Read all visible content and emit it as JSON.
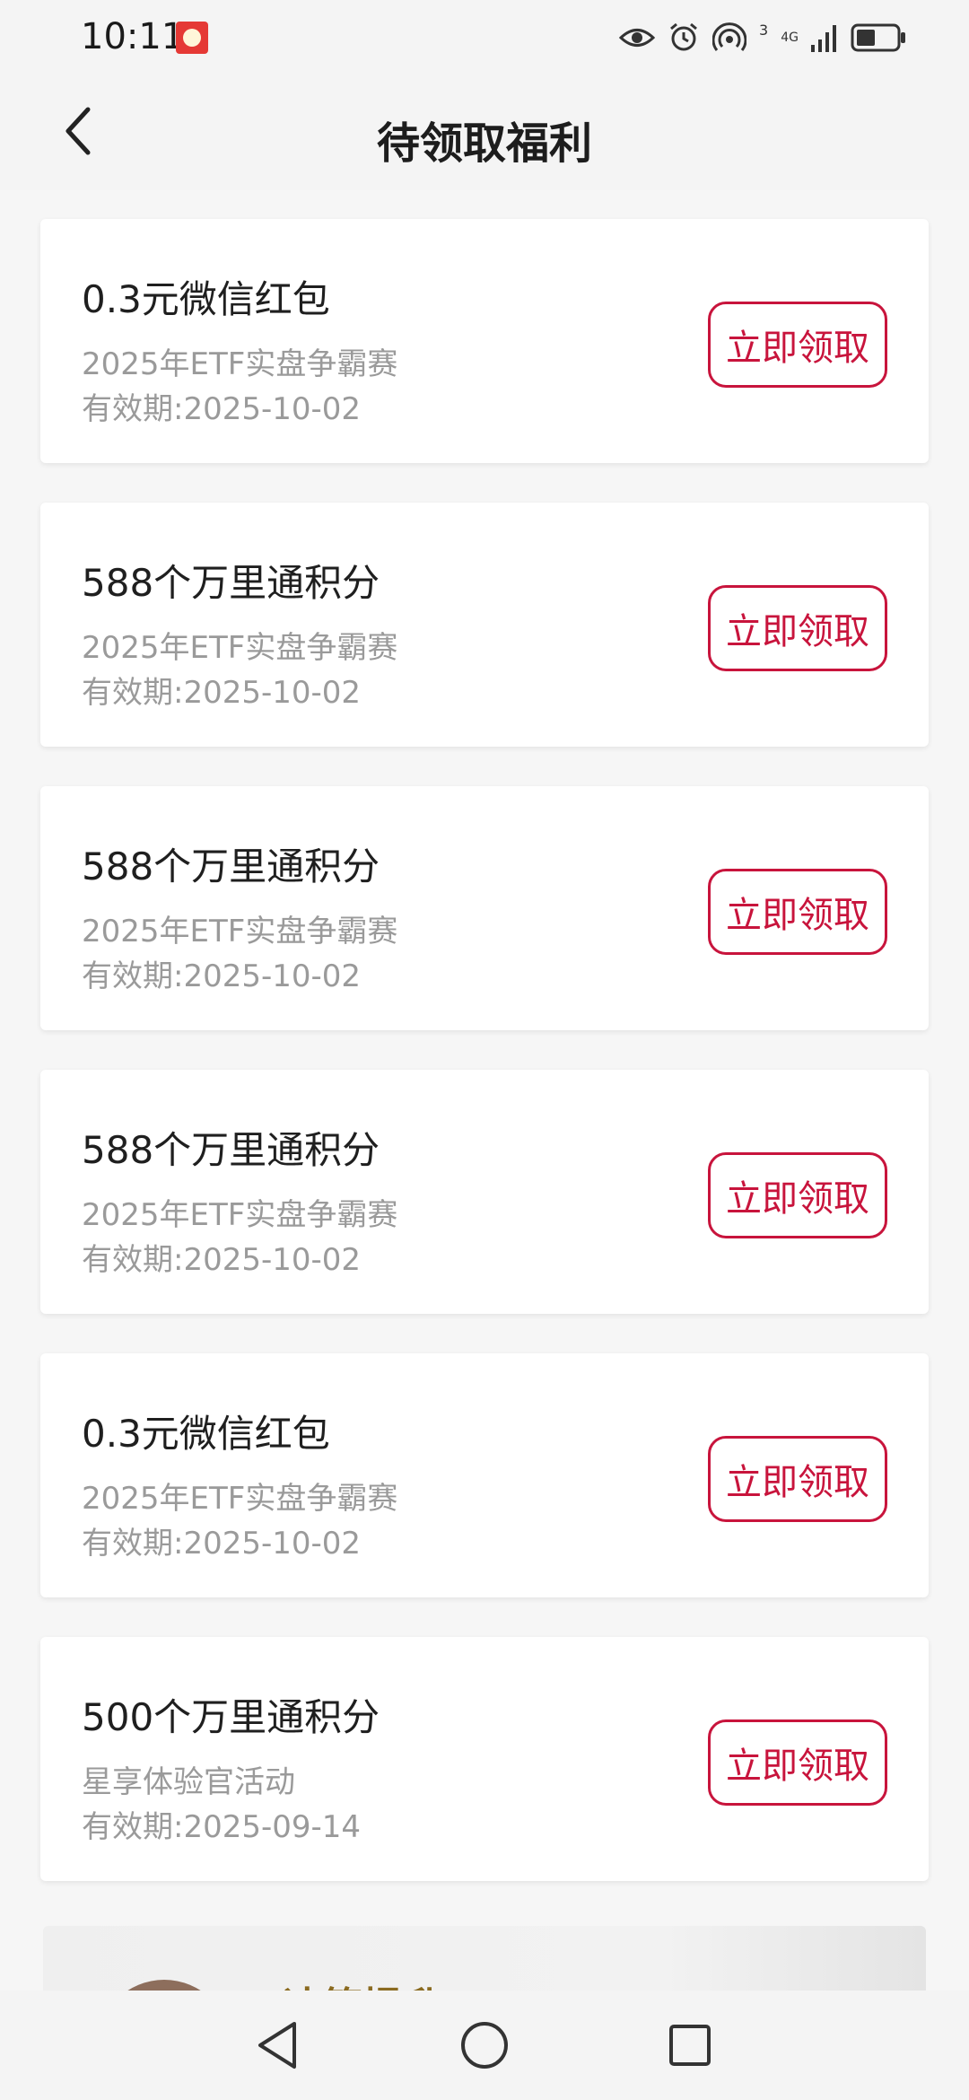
{
  "status_bar": {
    "time": "10:11",
    "network_label": "4G",
    "sim_label": "3"
  },
  "header": {
    "title": "待领取福利"
  },
  "rewards": [
    {
      "title": "0.3元微信红包",
      "source": "2025年ETF实盘争霸赛",
      "expiry": "有效期:2025-10-02",
      "button": "立即领取"
    },
    {
      "title": "588个万里通积分",
      "source": "2025年ETF实盘争霸赛",
      "expiry": "有效期:2025-10-02",
      "button": "立即领取"
    },
    {
      "title": "588个万里通积分",
      "source": "2025年ETF实盘争霸赛",
      "expiry": "有效期:2025-10-02",
      "button": "立即领取"
    },
    {
      "title": "588个万里通积分",
      "source": "2025年ETF实盘争霸赛",
      "expiry": "有效期:2025-10-02",
      "button": "立即领取"
    },
    {
      "title": "0.3元微信红包",
      "source": "2025年ETF实盘争霸赛",
      "expiry": "有效期:2025-10-02",
      "button": "立即领取"
    },
    {
      "title": "500个万里通积分",
      "source": "星享体验官活动",
      "expiry": "有效期:2025-09-14",
      "button": "立即领取"
    }
  ],
  "partial_card": {
    "name": "决策提升"
  },
  "colors": {
    "accent": "#c8143c",
    "background": "#f4f4f4",
    "card": "#ffffff",
    "secondary_text": "#9a9a9a"
  },
  "icons": {
    "back": "chevron-left-icon",
    "nav_back": "triangle-back-icon",
    "nav_home": "circle-home-icon",
    "nav_recents": "square-recents-icon"
  }
}
